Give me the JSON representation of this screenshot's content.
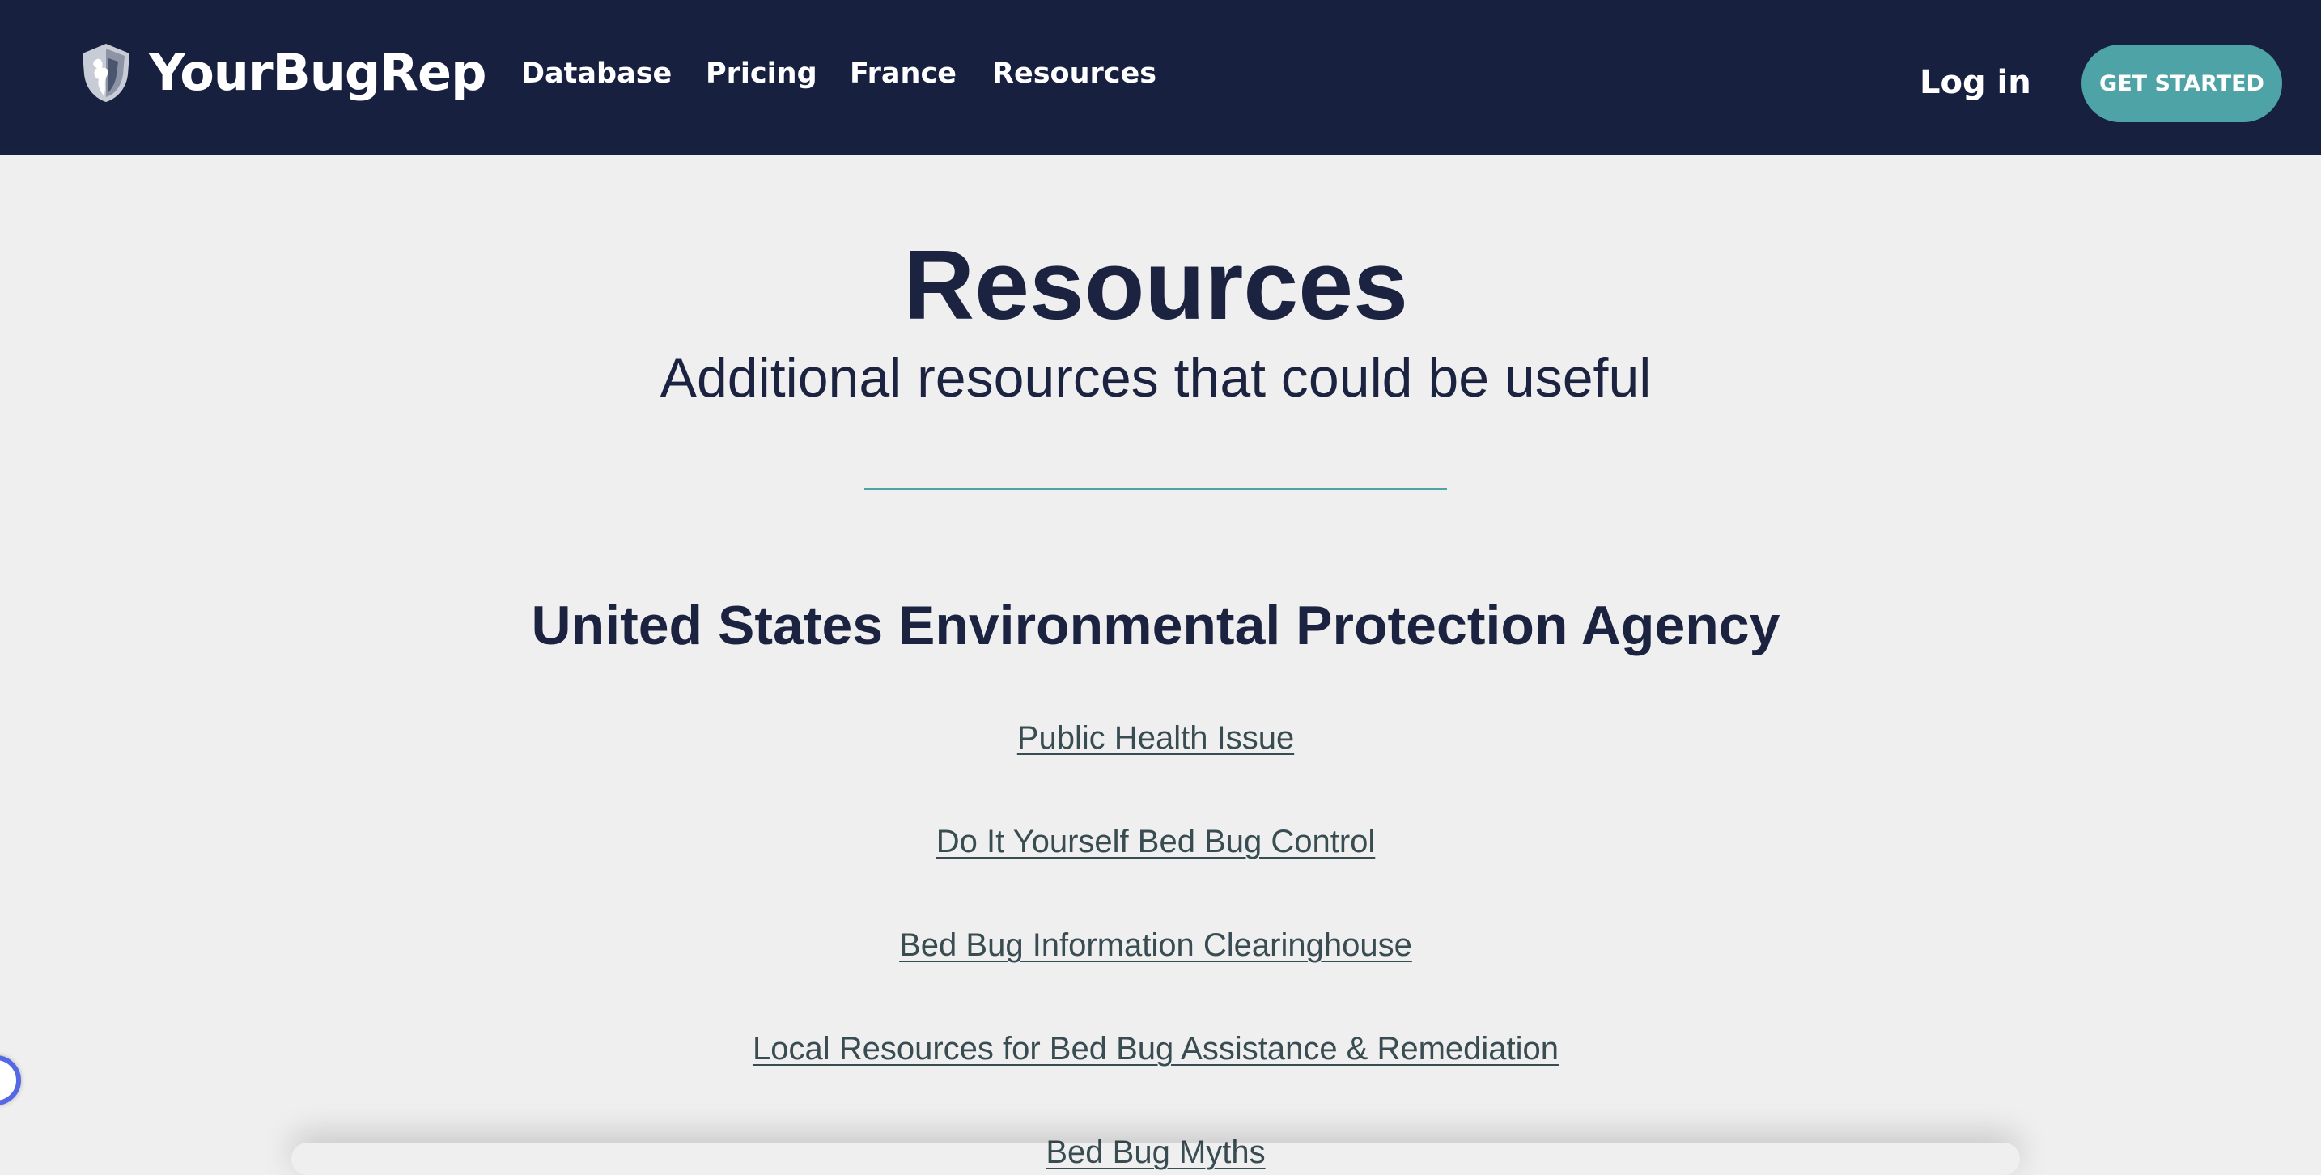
{
  "nav": {
    "logo_text": "YourBugRep",
    "links": [
      "Database",
      "Pricing",
      "France",
      "Resources"
    ],
    "login_label": "Log in",
    "cta_label": "GET STARTED"
  },
  "hero": {
    "title": "Resources",
    "subtitle": "Additional resources that could be useful"
  },
  "sections": [
    {
      "heading": "United States Environmental Protection Agency",
      "links": [
        "Public Health Issue",
        "Do It Yourself Bed Bug Control",
        "Bed Bug Information Clearinghouse",
        "Local Resources for Bed Bug Assistance & Remediation",
        "Bed Bug Myths"
      ]
    }
  ],
  "colors": {
    "navbar_bg": "#182040",
    "accent": "#4da3a5",
    "page_bg": "#efefef",
    "heading_text": "#1b2340",
    "link_text": "#384c52"
  },
  "icons": {
    "logo": "shield-bug-icon",
    "floating_widget": "accessibility-widget-icon"
  }
}
